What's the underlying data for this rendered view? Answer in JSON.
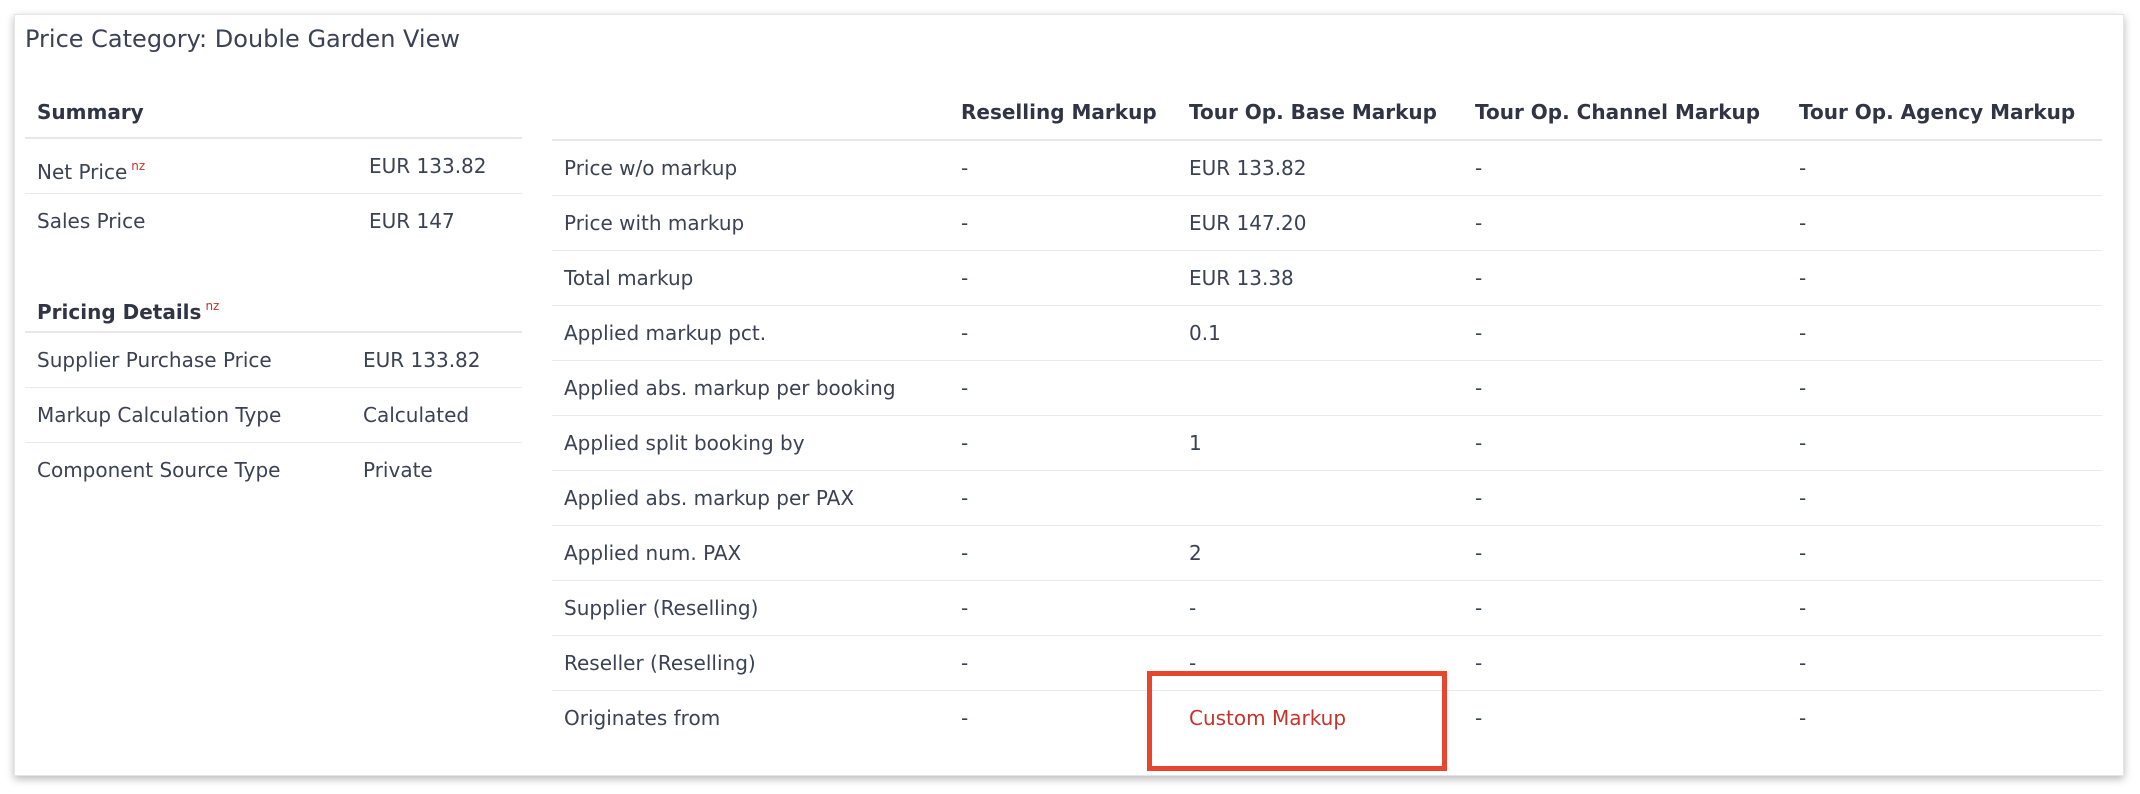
{
  "title": "Price Category: Double Garden View",
  "summary": {
    "heading": "Summary",
    "rows": [
      {
        "label": "Net Price",
        "sup": "nz",
        "value": "EUR 133.82"
      },
      {
        "label": "Sales Price",
        "value": "EUR 147"
      }
    ]
  },
  "pricing_details": {
    "heading": "Pricing Details",
    "sup": "nz",
    "rows": [
      {
        "label": "Supplier Purchase Price",
        "value": "EUR 133.82"
      },
      {
        "label": "Markup Calculation Type",
        "value": "Calculated"
      },
      {
        "label": "Component Source Type",
        "value": "Private"
      }
    ]
  },
  "markup_table": {
    "columns": [
      "",
      "Reselling Markup",
      "Tour Op. Base Markup",
      "Tour Op. Channel Markup",
      "Tour Op. Agency Markup"
    ],
    "rows": [
      {
        "label": "Price w/o markup",
        "cells": [
          "-",
          "EUR 133.82",
          "-",
          "-"
        ]
      },
      {
        "label": "Price with markup",
        "cells": [
          "-",
          "EUR 147.20",
          "-",
          "-"
        ]
      },
      {
        "label": "Total markup",
        "cells": [
          "-",
          "EUR 13.38",
          "-",
          "-"
        ]
      },
      {
        "label": "Applied markup pct.",
        "cells": [
          "-",
          "0.1",
          "-",
          "-"
        ]
      },
      {
        "label": "Applied abs. markup per booking",
        "cells": [
          "-",
          "",
          "-",
          "-"
        ]
      },
      {
        "label": "Applied split booking by",
        "cells": [
          "-",
          "1",
          "-",
          "-"
        ]
      },
      {
        "label": "Applied abs. markup per PAX",
        "cells": [
          "-",
          "",
          "-",
          "-"
        ]
      },
      {
        "label": "Applied num. PAX",
        "cells": [
          "-",
          "2",
          "-",
          "-"
        ]
      },
      {
        "label": "Supplier (Reselling)",
        "cells": [
          "-",
          "-",
          "-",
          "-"
        ]
      },
      {
        "label": "Reseller (Reselling)",
        "cells": [
          "-",
          "-",
          "-",
          "-"
        ]
      },
      {
        "label": "Originates from",
        "cells": [
          "-",
          "Custom Markup",
          "-",
          "-"
        ]
      }
    ]
  },
  "colors": {
    "accent_red": "#c8322b",
    "highlight_box": "#e8452e",
    "text": "#3a4253"
  }
}
